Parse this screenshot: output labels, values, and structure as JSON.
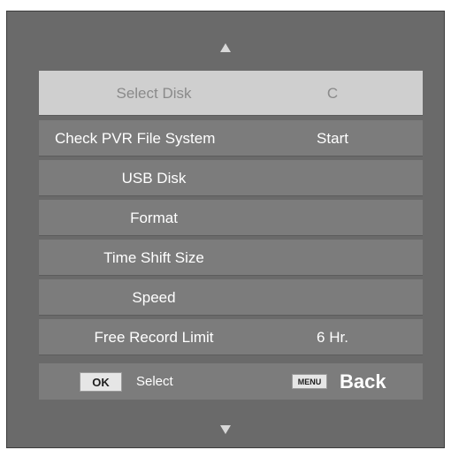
{
  "menu": {
    "items": [
      {
        "label": "Select Disk",
        "value": "C"
      },
      {
        "label": "Check PVR File System",
        "value": "Start"
      },
      {
        "label": "USB Disk",
        "value": ""
      },
      {
        "label": "Format",
        "value": ""
      },
      {
        "label": "Time Shift Size",
        "value": ""
      },
      {
        "label": "Speed",
        "value": ""
      },
      {
        "label": "Free Record Limit",
        "value": "6 Hr."
      }
    ],
    "selected_index": 0
  },
  "footer": {
    "ok_key": "OK",
    "ok_action": "Select",
    "menu_key": "MENU",
    "menu_action": "Back"
  },
  "icons": {
    "scroll_up": "triangle-up-icon",
    "scroll_down": "triangle-down-icon"
  },
  "colors": {
    "panel_bg": "#6a6a6a",
    "row_bg": "#7c7c7c",
    "selected_row_bg": "#cfcfcf",
    "selected_text": "#8a8a8a",
    "text": "#ffffff"
  }
}
